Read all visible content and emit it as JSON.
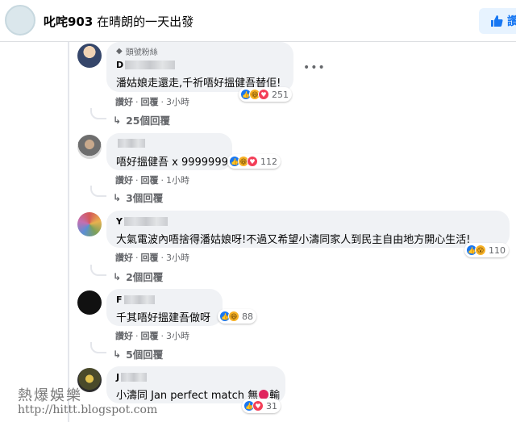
{
  "header": {
    "page_name": "叱咤903",
    "post_title": "在晴朗的一天出發",
    "like_label": "讚"
  },
  "comments": [
    {
      "badge": "頭號粉絲",
      "author": "D",
      "text": "潘姑娘走還走,千祈唔好搵健吾替佢!",
      "reaction_count": "251",
      "like_label": "讚好",
      "reply_label": "回覆",
      "time": "3小時",
      "replies_label": "25個回覆"
    },
    {
      "author": "",
      "text": "唔好搵健吾 x 9999999",
      "reaction_count": "112",
      "like_label": "讚好",
      "reply_label": "回覆",
      "time": "1小時",
      "replies_label": "3個回覆"
    },
    {
      "author": "Y",
      "text": "大氣電波內唔捨得潘姑娘呀!不過又希望小濤同家人到民主自由地方開心生活!",
      "reaction_count": "110",
      "like_label": "讚好",
      "reply_label": "回覆",
      "time": "3小時",
      "replies_label": "2個回覆"
    },
    {
      "author": "F",
      "text": "千其唔好搵建吾做呀",
      "reaction_count": "88",
      "like_label": "讚好",
      "reply_label": "回覆",
      "time": "3小時",
      "replies_label": "5個回覆"
    },
    {
      "author": "J",
      "text": "小濤同 Jan perfect match 無",
      "text_tail": "輸",
      "reaction_count": "31"
    }
  ],
  "watermark": {
    "line1": "熱爆娛樂",
    "line2": "http://hittt.blogspot.com"
  },
  "colors": {
    "accent": "#1877f2",
    "bubble": "#f0f2f5",
    "secondary_text": "#65676b"
  },
  "icons": [
    "like-thumb-icon",
    "haha-icon",
    "love-icon",
    "gem-icon",
    "reply-arrow-icon",
    "more-options-icon"
  ]
}
